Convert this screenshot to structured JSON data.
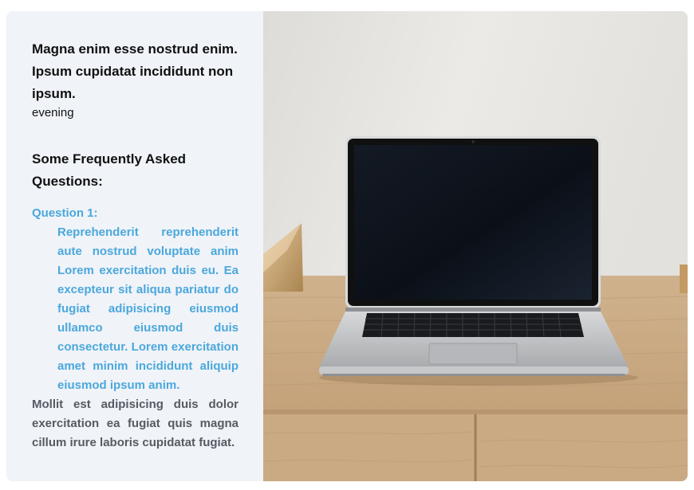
{
  "hero": {
    "headline": "Magna enim esse nostrud enim. Ipsum cupidatat incididunt non ipsum.",
    "subline": "evening"
  },
  "faq": {
    "title": "Some Frequently Asked Questions:",
    "items": [
      {
        "label": "Question 1:",
        "answer": "Reprehenderit reprehenderit aute nostrud voluptate anim Lorem exercitation duis eu. Ea excepteur sit aliqua pariatur do fugiat adipisicing eiusmod ullamco eiusmod duis consectetur. Lorem exercitation amet minim incididunt aliquip eiusmod ipsum anim."
      }
    ],
    "body": "Mollit est adipisicing duis dolor exercitation ea fugiat quis magna cillum irure laboris cupidatat fugiat."
  },
  "image": {
    "subject": "laptop-on-wooden-desk-photo"
  },
  "colors": {
    "panel_bg": "#f0f3f8",
    "accent": "#4ba8dc",
    "body_text": "#555b63"
  }
}
